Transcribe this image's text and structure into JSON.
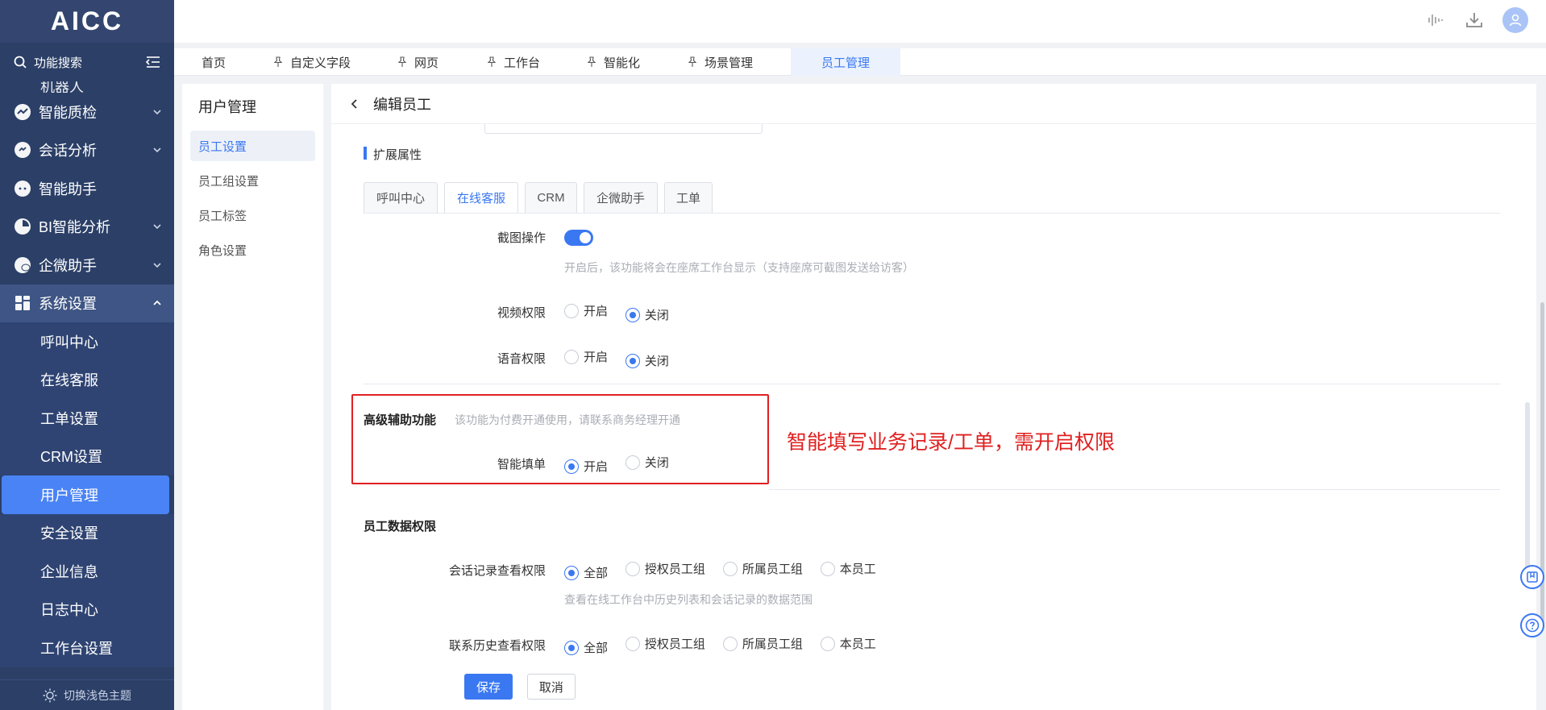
{
  "app": {
    "logo": "AICC"
  },
  "sidebar": {
    "search_label": "功能搜索",
    "partial_item": "机器人",
    "items": [
      {
        "label": "智能质检",
        "icon": "chart-icon",
        "expandable": true
      },
      {
        "label": "会话分析",
        "icon": "chat-icon",
        "expandable": true
      },
      {
        "label": "智能助手",
        "icon": "assistant-icon",
        "expandable": false
      },
      {
        "label": "BI智能分析",
        "icon": "pie-icon",
        "expandable": true
      },
      {
        "label": "企微助手",
        "icon": "wechat-icon",
        "expandable": true
      },
      {
        "label": "系统设置",
        "icon": "grid-icon",
        "expandable": true
      }
    ],
    "sub_items": [
      "呼叫中心",
      "在线客服",
      "工单设置",
      "CRM设置",
      "用户管理",
      "安全设置",
      "企业信息",
      "日志中心",
      "工作台设置"
    ],
    "active_sub": "用户管理",
    "theme_toggle": "切换浅色主题"
  },
  "tabs": [
    {
      "label": "首页",
      "pinned": false
    },
    {
      "label": "自定义字段",
      "pinned": true
    },
    {
      "label": "网页",
      "pinned": true
    },
    {
      "label": "工作台",
      "pinned": true
    },
    {
      "label": "智能化",
      "pinned": true
    },
    {
      "label": "场景管理",
      "pinned": true
    },
    {
      "label": "员工管理",
      "pinned": false,
      "active": true
    }
  ],
  "subnav": {
    "title": "用户管理",
    "items": [
      "员工设置",
      "员工组设置",
      "员工标签",
      "角色设置"
    ],
    "active": "员工设置"
  },
  "main": {
    "title": "编辑员工",
    "ext_section_title": "扩展属性",
    "ext_tabs": [
      "呼叫中心",
      "在线客服",
      "CRM",
      "企微助手",
      "工单"
    ],
    "ext_active_tab": "在线客服",
    "screenshot": {
      "label": "截图操作",
      "enabled": true,
      "help": "开启后，该功能将会在座席工作台显示（支持座席可截图发送给访客）"
    },
    "video": {
      "label": "视频权限",
      "options": [
        "开启",
        "关闭"
      ],
      "selected": "关闭"
    },
    "voice": {
      "label": "语音权限",
      "options": [
        "开启",
        "关闭"
      ],
      "selected": "关闭"
    },
    "advanced": {
      "title": "高级辅助功能",
      "help": "该功能为付费开通使用，请联系商务经理开通",
      "smart_fill": {
        "label": "智能填单",
        "options": [
          "开启",
          "关闭"
        ],
        "selected": "开启"
      }
    },
    "annotation": "智能填写业务记录/工单，需开启权限",
    "data_perm": {
      "title": "员工数据权限",
      "session": {
        "label": "会话记录查看权限",
        "options": [
          "全部",
          "授权员工组",
          "所属员工组",
          "本员工"
        ],
        "selected": "全部",
        "help": "查看在线工作台中历史列表和会话记录的数据范围"
      },
      "contact": {
        "label": "联系历史查看权限",
        "options": [
          "全部",
          "授权员工组",
          "所属员工组",
          "本员工"
        ],
        "selected": "全部"
      }
    },
    "buttons": {
      "save": "保存",
      "cancel": "取消"
    }
  },
  "colors": {
    "accent": "#3a78f2",
    "sidebar_bg": "#2b3f67",
    "annotation": "#e02020"
  }
}
